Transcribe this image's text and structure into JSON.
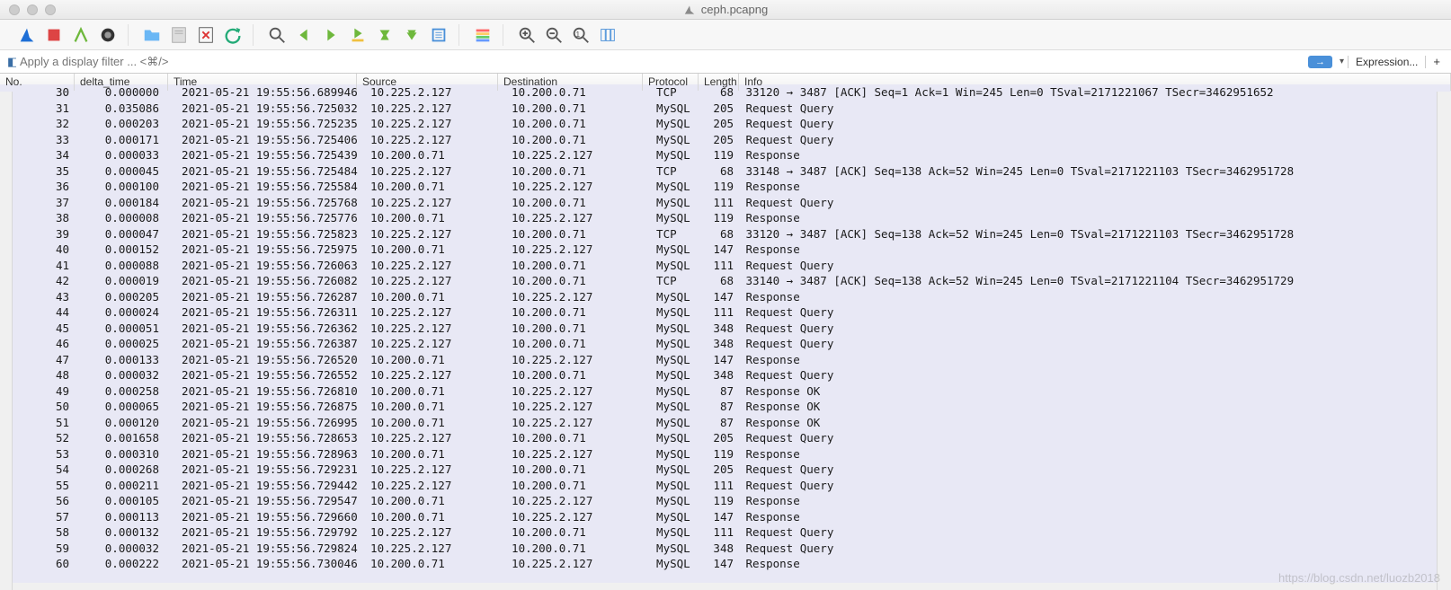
{
  "title": "ceph.pcapng",
  "filter_placeholder": "Apply a display filter ... <⌘/>",
  "expression_label": "Expression...",
  "columns": {
    "no": "No.",
    "delta": "delta_time",
    "time": "Time",
    "src": "Source",
    "dst": "Destination",
    "proto": "Protocol",
    "len": "Length",
    "info": "Info"
  },
  "rows": [
    {
      "no": "30",
      "dt": "0.000000",
      "time": "2021-05-21 19:55:56.689946",
      "src": "10.225.2.127",
      "dst": "10.200.0.71",
      "proto": "TCP",
      "len": "68",
      "info": "33120 → 3487 [ACK] Seq=1 Ack=1 Win=245 Len=0 TSval=2171221067 TSecr=3462951652"
    },
    {
      "no": "31",
      "dt": "0.035086",
      "time": "2021-05-21 19:55:56.725032",
      "src": "10.225.2.127",
      "dst": "10.200.0.71",
      "proto": "MySQL",
      "len": "205",
      "info": "Request Query"
    },
    {
      "no": "32",
      "dt": "0.000203",
      "time": "2021-05-21 19:55:56.725235",
      "src": "10.225.2.127",
      "dst": "10.200.0.71",
      "proto": "MySQL",
      "len": "205",
      "info": "Request Query"
    },
    {
      "no": "33",
      "dt": "0.000171",
      "time": "2021-05-21 19:55:56.725406",
      "src": "10.225.2.127",
      "dst": "10.200.0.71",
      "proto": "MySQL",
      "len": "205",
      "info": "Request Query"
    },
    {
      "no": "34",
      "dt": "0.000033",
      "time": "2021-05-21 19:55:56.725439",
      "src": "10.200.0.71",
      "dst": "10.225.2.127",
      "proto": "MySQL",
      "len": "119",
      "info": "Response"
    },
    {
      "no": "35",
      "dt": "0.000045",
      "time": "2021-05-21 19:55:56.725484",
      "src": "10.225.2.127",
      "dst": "10.200.0.71",
      "proto": "TCP",
      "len": "68",
      "info": "33148 → 3487 [ACK] Seq=138 Ack=52 Win=245 Len=0 TSval=2171221103 TSecr=3462951728"
    },
    {
      "no": "36",
      "dt": "0.000100",
      "time": "2021-05-21 19:55:56.725584",
      "src": "10.200.0.71",
      "dst": "10.225.2.127",
      "proto": "MySQL",
      "len": "119",
      "info": "Response"
    },
    {
      "no": "37",
      "dt": "0.000184",
      "time": "2021-05-21 19:55:56.725768",
      "src": "10.225.2.127",
      "dst": "10.200.0.71",
      "proto": "MySQL",
      "len": "111",
      "info": "Request Query"
    },
    {
      "no": "38",
      "dt": "0.000008",
      "time": "2021-05-21 19:55:56.725776",
      "src": "10.200.0.71",
      "dst": "10.225.2.127",
      "proto": "MySQL",
      "len": "119",
      "info": "Response"
    },
    {
      "no": "39",
      "dt": "0.000047",
      "time": "2021-05-21 19:55:56.725823",
      "src": "10.225.2.127",
      "dst": "10.200.0.71",
      "proto": "TCP",
      "len": "68",
      "info": "33120 → 3487 [ACK] Seq=138 Ack=52 Win=245 Len=0 TSval=2171221103 TSecr=3462951728"
    },
    {
      "no": "40",
      "dt": "0.000152",
      "time": "2021-05-21 19:55:56.725975",
      "src": "10.200.0.71",
      "dst": "10.225.2.127",
      "proto": "MySQL",
      "len": "147",
      "info": "Response"
    },
    {
      "no": "41",
      "dt": "0.000088",
      "time": "2021-05-21 19:55:56.726063",
      "src": "10.225.2.127",
      "dst": "10.200.0.71",
      "proto": "MySQL",
      "len": "111",
      "info": "Request Query"
    },
    {
      "no": "42",
      "dt": "0.000019",
      "time": "2021-05-21 19:55:56.726082",
      "src": "10.225.2.127",
      "dst": "10.200.0.71",
      "proto": "TCP",
      "len": "68",
      "info": "33140 → 3487 [ACK] Seq=138 Ack=52 Win=245 Len=0 TSval=2171221104 TSecr=3462951729"
    },
    {
      "no": "43",
      "dt": "0.000205",
      "time": "2021-05-21 19:55:56.726287",
      "src": "10.200.0.71",
      "dst": "10.225.2.127",
      "proto": "MySQL",
      "len": "147",
      "info": "Response"
    },
    {
      "no": "44",
      "dt": "0.000024",
      "time": "2021-05-21 19:55:56.726311",
      "src": "10.225.2.127",
      "dst": "10.200.0.71",
      "proto": "MySQL",
      "len": "111",
      "info": "Request Query"
    },
    {
      "no": "45",
      "dt": "0.000051",
      "time": "2021-05-21 19:55:56.726362",
      "src": "10.225.2.127",
      "dst": "10.200.0.71",
      "proto": "MySQL",
      "len": "348",
      "info": "Request Query"
    },
    {
      "no": "46",
      "dt": "0.000025",
      "time": "2021-05-21 19:55:56.726387",
      "src": "10.225.2.127",
      "dst": "10.200.0.71",
      "proto": "MySQL",
      "len": "348",
      "info": "Request Query"
    },
    {
      "no": "47",
      "dt": "0.000133",
      "time": "2021-05-21 19:55:56.726520",
      "src": "10.200.0.71",
      "dst": "10.225.2.127",
      "proto": "MySQL",
      "len": "147",
      "info": "Response"
    },
    {
      "no": "48",
      "dt": "0.000032",
      "time": "2021-05-21 19:55:56.726552",
      "src": "10.225.2.127",
      "dst": "10.200.0.71",
      "proto": "MySQL",
      "len": "348",
      "info": "Request Query"
    },
    {
      "no": "49",
      "dt": "0.000258",
      "time": "2021-05-21 19:55:56.726810",
      "src": "10.200.0.71",
      "dst": "10.225.2.127",
      "proto": "MySQL",
      "len": "87",
      "info": "Response OK"
    },
    {
      "no": "50",
      "dt": "0.000065",
      "time": "2021-05-21 19:55:56.726875",
      "src": "10.200.0.71",
      "dst": "10.225.2.127",
      "proto": "MySQL",
      "len": "87",
      "info": "Response OK"
    },
    {
      "no": "51",
      "dt": "0.000120",
      "time": "2021-05-21 19:55:56.726995",
      "src": "10.200.0.71",
      "dst": "10.225.2.127",
      "proto": "MySQL",
      "len": "87",
      "info": "Response OK"
    },
    {
      "no": "52",
      "dt": "0.001658",
      "time": "2021-05-21 19:55:56.728653",
      "src": "10.225.2.127",
      "dst": "10.200.0.71",
      "proto": "MySQL",
      "len": "205",
      "info": "Request Query"
    },
    {
      "no": "53",
      "dt": "0.000310",
      "time": "2021-05-21 19:55:56.728963",
      "src": "10.200.0.71",
      "dst": "10.225.2.127",
      "proto": "MySQL",
      "len": "119",
      "info": "Response"
    },
    {
      "no": "54",
      "dt": "0.000268",
      "time": "2021-05-21 19:55:56.729231",
      "src": "10.225.2.127",
      "dst": "10.200.0.71",
      "proto": "MySQL",
      "len": "205",
      "info": "Request Query"
    },
    {
      "no": "55",
      "dt": "0.000211",
      "time": "2021-05-21 19:55:56.729442",
      "src": "10.225.2.127",
      "dst": "10.200.0.71",
      "proto": "MySQL",
      "len": "111",
      "info": "Request Query"
    },
    {
      "no": "56",
      "dt": "0.000105",
      "time": "2021-05-21 19:55:56.729547",
      "src": "10.200.0.71",
      "dst": "10.225.2.127",
      "proto": "MySQL",
      "len": "119",
      "info": "Response"
    },
    {
      "no": "57",
      "dt": "0.000113",
      "time": "2021-05-21 19:55:56.729660",
      "src": "10.200.0.71",
      "dst": "10.225.2.127",
      "proto": "MySQL",
      "len": "147",
      "info": "Response"
    },
    {
      "no": "58",
      "dt": "0.000132",
      "time": "2021-05-21 19:55:56.729792",
      "src": "10.225.2.127",
      "dst": "10.200.0.71",
      "proto": "MySQL",
      "len": "111",
      "info": "Request Query"
    },
    {
      "no": "59",
      "dt": "0.000032",
      "time": "2021-05-21 19:55:56.729824",
      "src": "10.225.2.127",
      "dst": "10.200.0.71",
      "proto": "MySQL",
      "len": "348",
      "info": "Request Query"
    },
    {
      "no": "60",
      "dt": "0.000222",
      "time": "2021-05-21 19:55:56.730046",
      "src": "10.200.0.71",
      "dst": "10.225.2.127",
      "proto": "MySQL",
      "len": "147",
      "info": "Response"
    }
  ],
  "watermark": "https://blog.csdn.net/luozb2018"
}
